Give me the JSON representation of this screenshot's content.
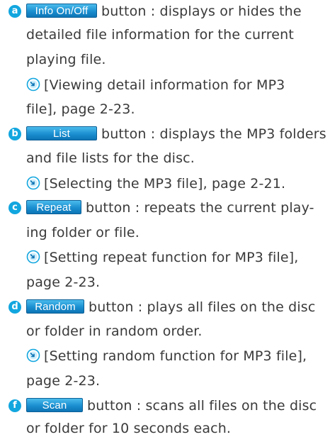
{
  "items": [
    {
      "letter": "a",
      "button": "Info On/Off",
      "lines": [
        "button : displays or hides the",
        "detailed file information for the current",
        "playing file."
      ],
      "ref_lines": [
        "[Viewing detail information for MP3",
        "file], page 2-23."
      ]
    },
    {
      "letter": "b",
      "button": "List",
      "lines": [
        "button : displays the MP3 folders",
        "and file lists for the disc."
      ],
      "ref_lines": [
        "[Selecting the MP3 file], page 2-21."
      ]
    },
    {
      "letter": "c",
      "button": "Repeat",
      "lines": [
        "button : repeats the current play-",
        "ing folder or file."
      ],
      "ref_lines": [
        "[Setting repeat function for MP3 file],",
        "page 2-23."
      ]
    },
    {
      "letter": "d",
      "button": "Random",
      "lines": [
        "button : plays all files on the disc",
        "or folder in random order."
      ],
      "ref_lines": [
        "[Setting random function for MP3 file],",
        "page 2-23."
      ]
    },
    {
      "letter": "f",
      "button": "Scan",
      "lines": [
        "button : scans all files on the disc",
        "or folder for 10 seconds each."
      ],
      "ref_lines": []
    }
  ],
  "icon_name": "reference-arrow-icon",
  "colors": {
    "bullet": "#12a6df",
    "button": "#1a8fd0",
    "text": "#3a3a3a"
  }
}
